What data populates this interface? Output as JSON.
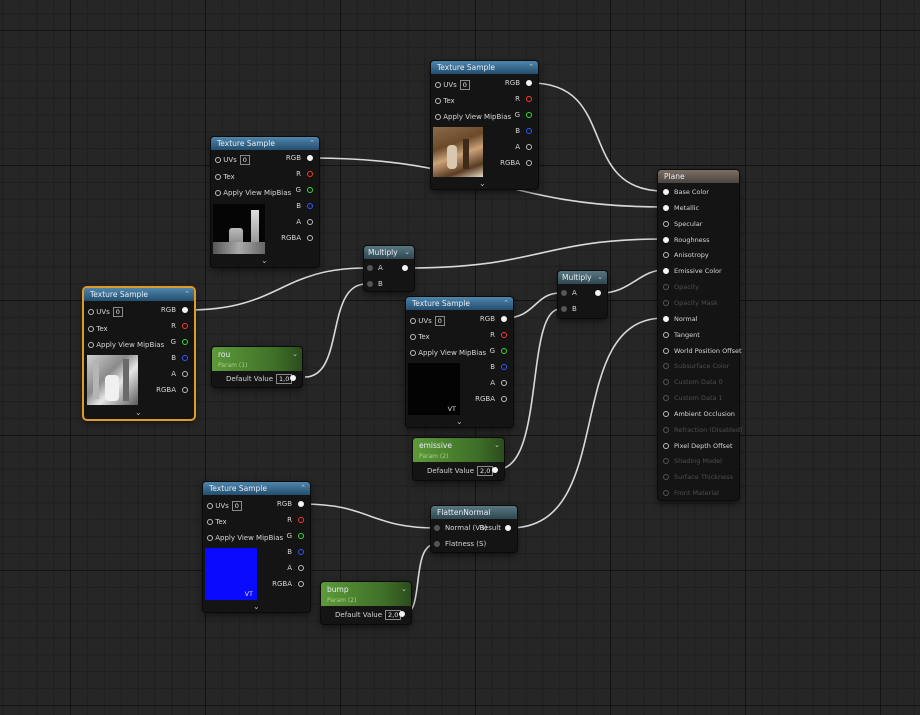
{
  "nodes": {
    "tex_top": {
      "title": "Texture Sample",
      "uvs_label": "UVs",
      "uvs_value": "0",
      "tex_label": "Tex",
      "mip_label": "Apply View MipBias",
      "out_rgb": "RGB",
      "out_r": "R",
      "out_g": "G",
      "out_b": "B",
      "out_a": "A",
      "out_rgba": "RGBA"
    },
    "tex_left_top": {
      "title": "Texture Sample",
      "uvs_label": "UVs",
      "uvs_value": "0",
      "tex_label": "Tex",
      "mip_label": "Apply View MipBias",
      "out_rgb": "RGB",
      "out_r": "R",
      "out_g": "G",
      "out_b": "B",
      "out_a": "A",
      "out_rgba": "RGBA"
    },
    "tex_selected": {
      "title": "Texture Sample",
      "uvs_label": "UVs",
      "uvs_value": "0",
      "tex_label": "Tex",
      "mip_label": "Apply View MipBias",
      "out_rgb": "RGB",
      "out_r": "R",
      "out_g": "G",
      "out_b": "B",
      "out_a": "A",
      "out_rgba": "RGBA"
    },
    "tex_middle": {
      "title": "Texture Sample",
      "uvs_label": "UVs",
      "uvs_value": "0",
      "tex_label": "Tex",
      "mip_label": "Apply View MipBias",
      "out_rgb": "RGB",
      "out_r": "R",
      "out_g": "G",
      "out_b": "B",
      "out_a": "A",
      "out_rgba": "RGBA",
      "vt": "VT"
    },
    "tex_bottom": {
      "title": "Texture Sample",
      "uvs_label": "UVs",
      "uvs_value": "0",
      "tex_label": "Tex",
      "mip_label": "Apply View MipBias",
      "out_rgb": "RGB",
      "out_r": "R",
      "out_g": "G",
      "out_b": "B",
      "out_a": "A",
      "out_rgba": "RGBA",
      "vt": "VT"
    },
    "multiply1": {
      "title": "Multiply",
      "in_a": "A",
      "in_b": "B"
    },
    "multiply2": {
      "title": "Multiply",
      "in_a": "A",
      "in_b": "B"
    },
    "param_rou": {
      "title": "rou",
      "subtitle": "Param (1)",
      "default_label": "Default Value",
      "default_value": "1,0"
    },
    "param_emissive": {
      "title": "emissive",
      "subtitle": "Param (2)",
      "default_label": "Default Value",
      "default_value": "2,0"
    },
    "param_bump": {
      "title": "bump",
      "subtitle": "Param (2)",
      "default_label": "Default Value",
      "default_value": "2,0"
    },
    "flatten": {
      "title": "FlattenNormal",
      "in_normal": "Normal (V3)",
      "in_flatness": "Flatness (S)",
      "out_result": "Result"
    },
    "plane": {
      "title": "Plane",
      "inputs": [
        "Base Color",
        "Metallic",
        "Specular",
        "Roughness",
        "Anisotropy",
        "Emissive Color",
        "Opacity",
        "Opacity Mask",
        "Normal",
        "Tangent",
        "World Position Offset",
        "Subsurface Color",
        "Custom Data 0",
        "Custom Data 1",
        "Ambient Occlusion",
        "Refraction (Disabled)",
        "Pixel Depth Offset",
        "Shading Model",
        "Surface Thickness",
        "Front Material"
      ],
      "active": [
        true,
        true,
        true,
        true,
        true,
        true,
        false,
        false,
        true,
        true,
        true,
        false,
        false,
        false,
        true,
        false,
        true,
        false,
        false,
        false
      ],
      "connected": [
        true,
        true,
        false,
        true,
        false,
        true,
        false,
        false,
        true,
        false,
        false,
        false,
        false,
        false,
        false,
        false,
        false,
        false,
        false,
        false
      ]
    }
  },
  "colors": {
    "wire": "#d8d8d8",
    "selected_border": "#e09a2a",
    "texture_header": "#3a6a8f",
    "param_header": "#4f8a30"
  }
}
